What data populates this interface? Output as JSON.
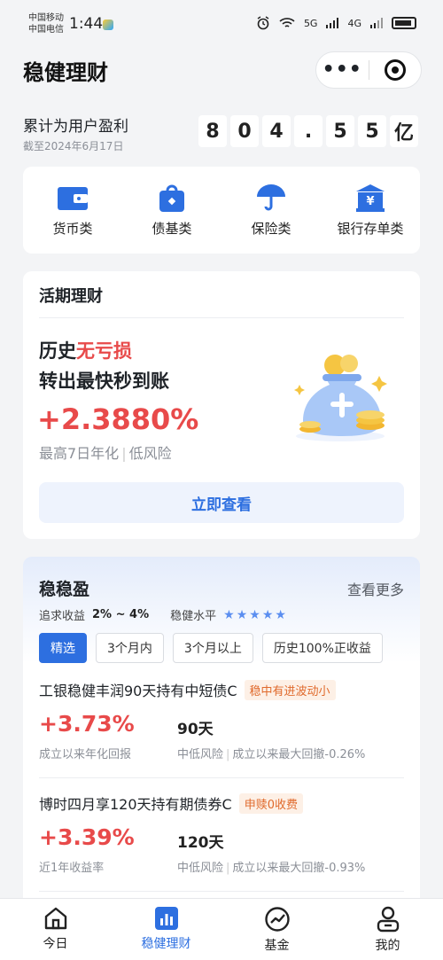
{
  "status_bar": {
    "carrier_1": "中国移动",
    "carrier_2": "中国电信",
    "time": "1:44",
    "network_1": "5G",
    "network_2": "4G"
  },
  "header": {
    "title": "稳健理财",
    "more_icon": "more-dots-icon",
    "target_icon": "target-icon"
  },
  "profit": {
    "label": "累计为用户盈利",
    "date": "截至2024年6月17日",
    "digits": [
      "8",
      "0",
      "4",
      ".",
      "5",
      "5",
      "亿"
    ]
  },
  "categories": [
    {
      "label": "货币类",
      "icon": "wallet-icon"
    },
    {
      "label": "债基类",
      "icon": "bag-icon"
    },
    {
      "label": "保险类",
      "icon": "umbrella-icon"
    },
    {
      "label": "银行存单类",
      "icon": "bank-icon"
    }
  ],
  "current": {
    "title": "活期理财",
    "line1_prefix": "历史",
    "line1_highlight": "无亏损",
    "line2": "转出最快秒到账",
    "rate": "+2.3880%",
    "rate_label": "最高7日年化",
    "risk": "低风险",
    "button": "立即查看",
    "accent": "#e84a4a"
  },
  "steady": {
    "title": "稳稳盈",
    "more": "查看更多",
    "goal_label": "追求收益",
    "goal_value": "2% ~ 4%",
    "level_label": "稳健水平",
    "stars": 5,
    "filters": [
      "精选",
      "3个月内",
      "3个月以上",
      "历史100%正收益"
    ],
    "active_filter": 0,
    "products": [
      {
        "name": "工银稳健丰润90天持有中短债C",
        "tag": "稳中有进波动小",
        "rate": "+3.73%",
        "rate_label": "成立以来年化回报",
        "term": "90天",
        "risk": "中低风险",
        "drawdown": "成立以来最大回撤-0.26%"
      },
      {
        "name": "博时四月享120天持有期债券C",
        "tag": "申赎0收费",
        "rate": "+3.39%",
        "rate_label": "近1年收益率",
        "term": "120天",
        "risk": "中低风险",
        "drawdown": "成立以来最大回撤-0.93%"
      }
    ]
  },
  "tabbar": [
    {
      "label": "今日",
      "icon": "home-icon"
    },
    {
      "label": "稳健理财",
      "icon": "bar-chart-icon",
      "active": true
    },
    {
      "label": "基金",
      "icon": "trend-icon"
    },
    {
      "label": "我的",
      "icon": "user-icon"
    }
  ]
}
